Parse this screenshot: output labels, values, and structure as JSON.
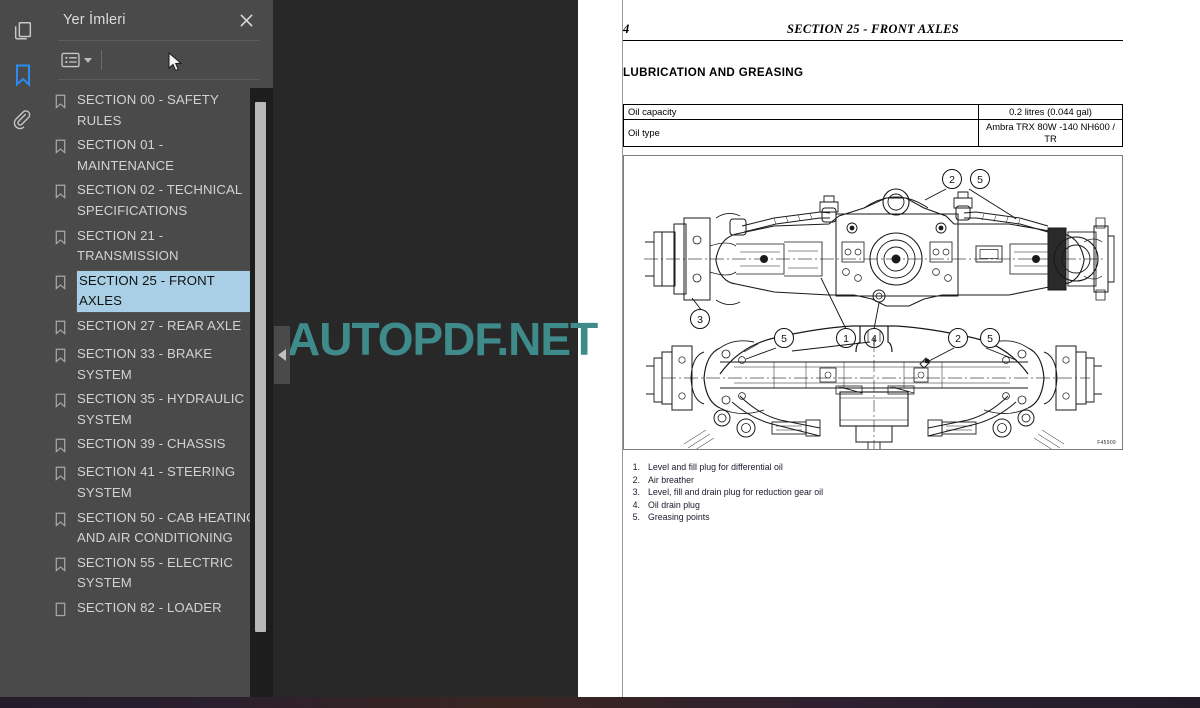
{
  "app": {
    "rail_icons": [
      {
        "name": "pages-thumbnails-icon",
        "label": "Sayfa Küçük Resimleri",
        "active": false
      },
      {
        "name": "bookmark-icon",
        "label": "Yer İmleri",
        "active": true
      },
      {
        "name": "attachment-icon",
        "label": "Ekler",
        "active": false
      }
    ]
  },
  "bookmarks_panel": {
    "title": "Yer İmleri",
    "close_label": "×",
    "options_button_label": "Seçenekler",
    "items": [
      {
        "label": "SECTION 00 - SAFETY RULES",
        "selected": false
      },
      {
        "label": "SECTION 01 - MAINTENANCE",
        "selected": false
      },
      {
        "label": "SECTION 02 - TECHNICAL SPECIFICATIONS",
        "selected": false
      },
      {
        "label": "SECTION 21 - TRANSMISSION",
        "selected": false
      },
      {
        "label": "SECTION 25 - FRONT AXLES",
        "selected": true
      },
      {
        "label": "SECTION 27 - REAR AXLE",
        "selected": false
      },
      {
        "label": "SECTION 33 - BRAKE SYSTEM",
        "selected": false
      },
      {
        "label": "SECTION 35 - HYDRAULIC SYSTEM",
        "selected": false
      },
      {
        "label": "SECTION 39 - CHASSIS",
        "selected": false
      },
      {
        "label": "SECTION 41 - STEERING SYSTEM",
        "selected": false
      },
      {
        "label": "SECTION 50 - CAB HEATING AND AIR CONDITIONING",
        "selected": false
      },
      {
        "label": "SECTION 55 - ELECTRIC SYSTEM",
        "selected": false
      },
      {
        "label": "SECTION 82 - LOADER",
        "selected": false
      }
    ]
  },
  "document": {
    "page_number": "4",
    "running_head": "SECTION 25 - FRONT AXLES",
    "heading": "LUBRICATION AND GREASING",
    "spec_table": {
      "rows": [
        {
          "key": "Oil capacity",
          "value": "0.2 litres (0.044 gal)"
        },
        {
          "key": "Oil type",
          "value": "Ambra TRX 80W -140 NH600 / TR"
        }
      ]
    },
    "figure": {
      "reference_code": "F45909",
      "callouts_top": [
        "2",
        "5",
        "3",
        "1",
        "4"
      ],
      "callouts_bottom": [
        "5",
        "2",
        "5"
      ]
    },
    "legend": [
      {
        "num": "1.",
        "text": "Level and fill plug for differential oil"
      },
      {
        "num": "2.",
        "text": "Air breather"
      },
      {
        "num": "3.",
        "text": "Level, fill and drain plug for reduction gear oil"
      },
      {
        "num": "4.",
        "text": "Oil drain plug"
      },
      {
        "num": "5.",
        "text": "Greasing points"
      }
    ]
  },
  "watermark": {
    "text": "AUTOPDF.NET",
    "color": "#3f8b8b"
  },
  "colors": {
    "panel_bg": "#4a4a4a",
    "viewer_bg": "#282828",
    "selection": "#a9cfe6",
    "accent": "#2a8cf0"
  }
}
